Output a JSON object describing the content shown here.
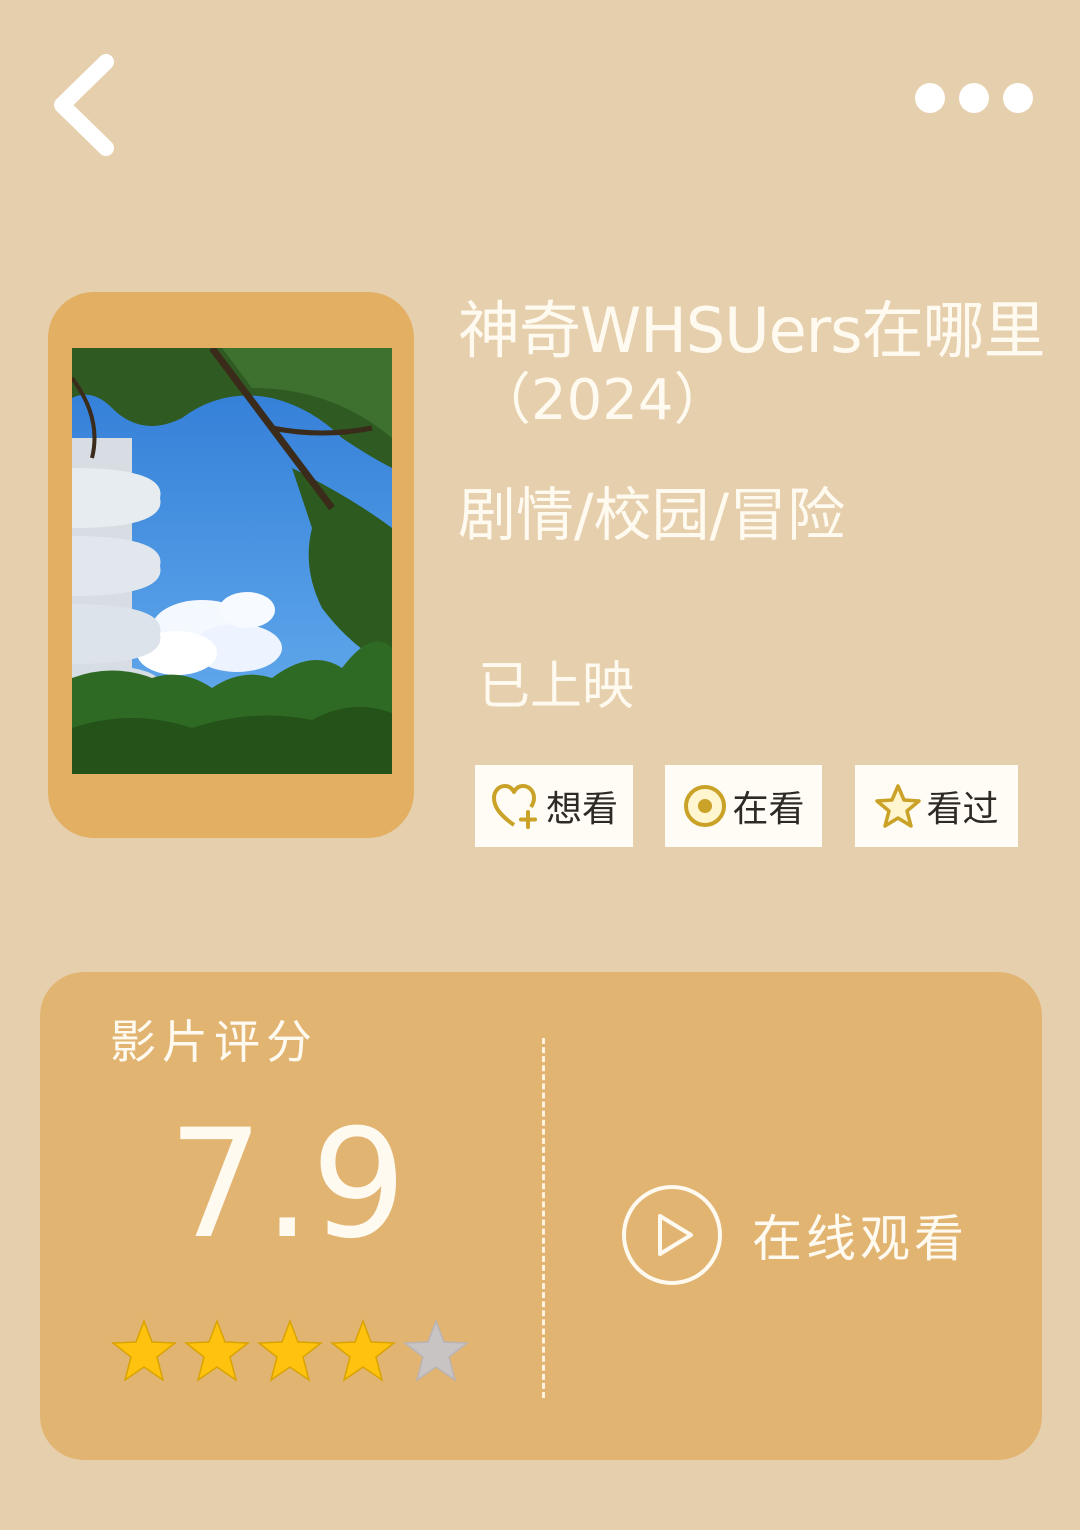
{
  "header": {
    "back_icon": "chevron-left-icon",
    "more_icon": "more-horizontal-icon"
  },
  "movie": {
    "title": "神奇WHSUers在哪里",
    "year": "（2024）",
    "genres": "剧情/校园/冒险",
    "status": "已上映",
    "poster_description": "campus building and trees against blue sky"
  },
  "actions": [
    {
      "label": "想看",
      "icon": "heart-plus-icon"
    },
    {
      "label": "在看",
      "icon": "target-circle-icon"
    },
    {
      "label": "看过",
      "icon": "star-outline-icon"
    }
  ],
  "rating": {
    "label": "影片评分",
    "score": "7.9",
    "stars_filled": 4,
    "stars_total": 5
  },
  "watch": {
    "label": "在线观看",
    "icon": "play-circle-icon"
  },
  "colors": {
    "background": "#e6cfad",
    "card": "#e2b472",
    "poster_frame": "#e2af63",
    "star_filled": "#ffc20e",
    "star_empty": "#c9c4c4",
    "text_light": "#fffaf0"
  }
}
